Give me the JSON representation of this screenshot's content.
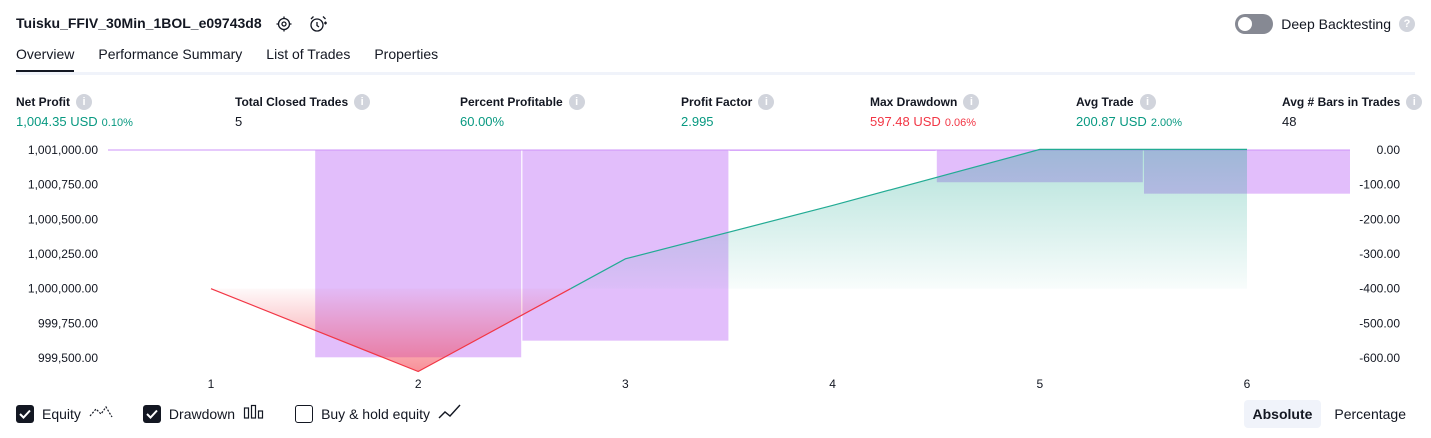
{
  "header": {
    "strategy_name": "Tuisku_FFIV_30Min_1BOL_e09743d8",
    "deep_backtesting_label": "Deep Backtesting",
    "deep_backtesting_enabled": false
  },
  "tabs": [
    {
      "label": "Overview",
      "active": true
    },
    {
      "label": "Performance Summary",
      "active": false
    },
    {
      "label": "List of Trades",
      "active": false
    },
    {
      "label": "Properties",
      "active": false
    }
  ],
  "metrics": {
    "net_profit": {
      "label": "Net Profit",
      "value": "1,004.35 USD",
      "pct": "0.10%"
    },
    "total_closed_trades": {
      "label": "Total Closed Trades",
      "value": "5"
    },
    "percent_profitable": {
      "label": "Percent Profitable",
      "value": "60.00%"
    },
    "profit_factor": {
      "label": "Profit Factor",
      "value": "2.995"
    },
    "max_drawdown": {
      "label": "Max Drawdown",
      "value": "597.48 USD",
      "pct": "0.06%"
    },
    "avg_trade": {
      "label": "Avg Trade",
      "value": "200.87 USD",
      "pct": "2.00%"
    },
    "avg_bars": {
      "label": "Avg # Bars in Trades",
      "value": "48"
    }
  },
  "colors": {
    "positive": "#089981",
    "negative": "#f23645",
    "drawdown_bar": "#ce93f8",
    "equity_line": "#22ab94"
  },
  "legend": {
    "equity": {
      "label": "Equity",
      "checked": true
    },
    "drawdown": {
      "label": "Drawdown",
      "checked": true
    },
    "buy_hold": {
      "label": "Buy & hold equity",
      "checked": false
    }
  },
  "modes": {
    "absolute": "Absolute",
    "percentage": "Percentage",
    "active": "absolute"
  },
  "chart_data": {
    "type": "line",
    "x": [
      1,
      2,
      3,
      4,
      5,
      6
    ],
    "x_tick_labels": [
      "1",
      "2",
      "3",
      "4",
      "5",
      "6"
    ],
    "y_left_ticks": [
      "1,001,000.00",
      "1,000,750.00",
      "1,000,500.00",
      "1,000,250.00",
      "1,000,000.00",
      "999,750.00",
      "999,500.00"
    ],
    "y_left_range": [
      999500,
      1001000
    ],
    "y_right_ticks": [
      "0.00",
      "-100.00",
      "-200.00",
      "-300.00",
      "-400.00",
      "-500.00",
      "-600.00"
    ],
    "y_right_range": [
      -600,
      0
    ],
    "series": [
      {
        "name": "Equity",
        "values": [
          1000000,
          999402.52,
          1000215,
          1000600,
          1001004.35,
          1001004.35
        ]
      },
      {
        "name": "Drawdown",
        "values": [
          -598,
          -550,
          -2,
          -93,
          -126
        ]
      }
    ],
    "drawdown_bar_slots": [
      2,
      3,
      4,
      5,
      6
    ],
    "baseline": 1000000
  }
}
